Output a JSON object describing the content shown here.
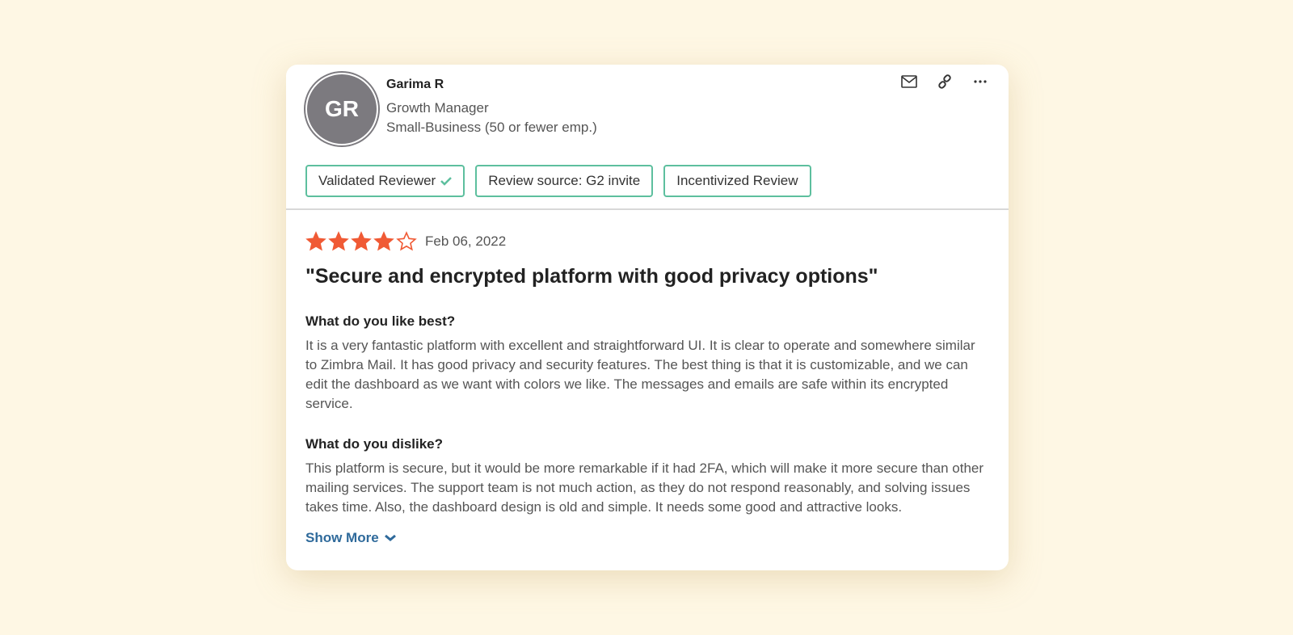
{
  "reviewer": {
    "initials": "GR",
    "name": "Garima R",
    "role": "Growth Manager",
    "segment": "Small-Business (50 or fewer emp.)"
  },
  "actions": [
    "mail-icon",
    "link-icon",
    "more-icon"
  ],
  "badges": [
    {
      "label": "Validated Reviewer",
      "icon": "check-icon"
    },
    {
      "label": "Review source: G2 invite"
    },
    {
      "label": "Incentivized Review"
    }
  ],
  "review": {
    "rating": 4,
    "max_rating": 5,
    "date": "Feb 06, 2022",
    "title": "\"Secure and encrypted platform with good privacy options\"",
    "q1": "What do you like best?",
    "a1": "It is a very fantastic platform with excellent and straightforward UI. It is clear to operate and somewhere similar to Zimbra Mail. It has good privacy and security features. The best thing is that it is customizable, and we can edit the dashboard as we want with colors we like. The messages and emails are safe within its encrypted service.",
    "q2": "What do you dislike?",
    "a2": "This platform is secure, but it would be more remarkable if it had 2FA, which will make it more secure than other mailing services. The support team is not much action, as they do not respond reasonably, and solving issues takes time. Also, the dashboard design is old and simple. It needs some good and attractive looks.",
    "show_more": "Show More"
  },
  "colors": {
    "star": "#f05a35",
    "badge_border": "#5dbf9e",
    "link": "#2f6a9b"
  }
}
